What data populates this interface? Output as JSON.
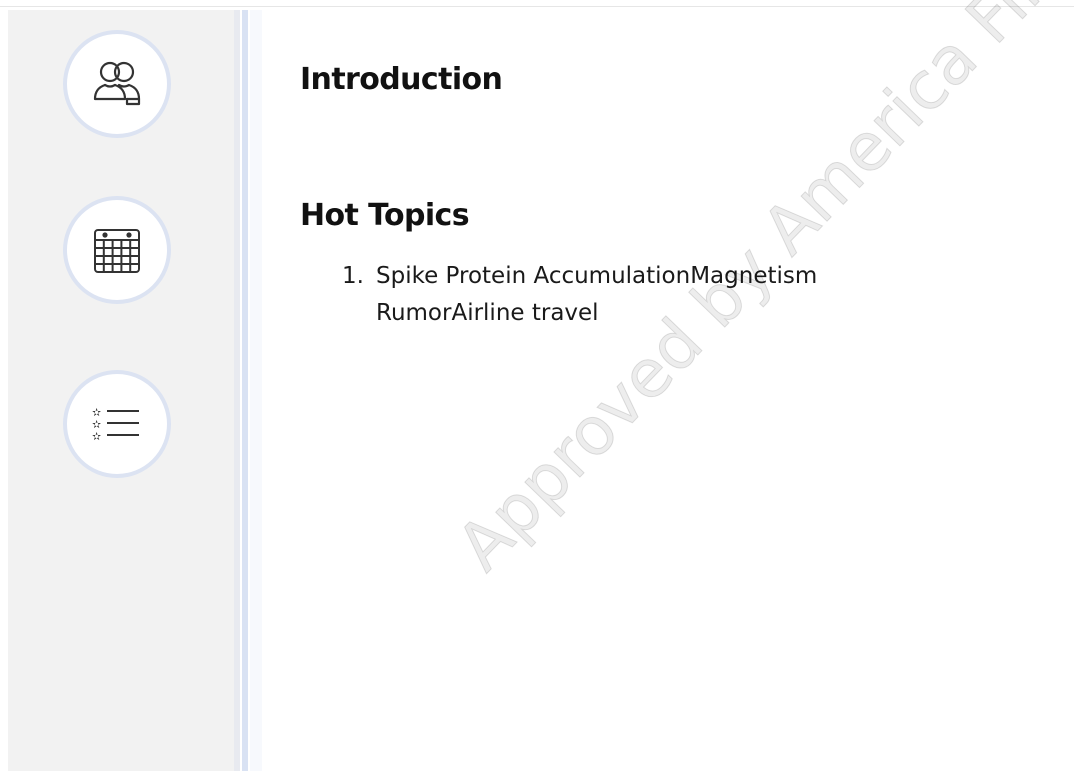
{
  "nav": {
    "items": [
      {
        "icon": "team-icon"
      },
      {
        "icon": "calendar-icon"
      },
      {
        "icon": "starred-list-icon"
      }
    ]
  },
  "content": {
    "intro_heading": "Introduction",
    "topics_heading": "Hot Topics",
    "topics": [
      {
        "number": "1.",
        "text": "Spike Protein AccumulationMagnetism RumorAirline travel"
      }
    ]
  },
  "watermark": {
    "text": "Approved by America First Leg"
  },
  "colors": {
    "sidebar_bg": "#f2f2f2",
    "nav_ring": "#dce3f2",
    "divider_blue": "#d9e2f3",
    "text": "#111111"
  }
}
